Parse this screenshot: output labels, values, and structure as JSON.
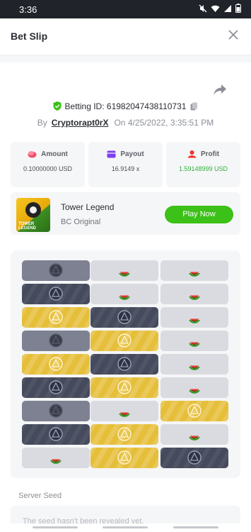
{
  "status_bar": {
    "time": "3:36"
  },
  "header": {
    "title": "Bet Slip",
    "close_icon": "close-icon"
  },
  "bet": {
    "betting_id": "Betting ID: 61982047438110731",
    "by_label": "By",
    "user": "Cryptorapt0rX",
    "on_label": "On",
    "datetime": "4/25/2022, 3:35:51 PM"
  },
  "stats": [
    {
      "label": "Amount",
      "value": "0.10000000 USD",
      "icon": "coins-icon",
      "icon_color": "#f24e6b"
    },
    {
      "label": "Payout",
      "value": "16.9149 x",
      "icon": "wallet-icon",
      "icon_color": "#7b3ff2"
    },
    {
      "label": "Profit",
      "value": "1.59148999 USD",
      "icon": "profit-icon",
      "icon_color": "#e8342e"
    }
  ],
  "game": {
    "name": "Tower Legend",
    "subtitle": "BC Original",
    "play_label": "Play Now",
    "thumb_text": "TOWER LEGEND"
  },
  "board": {
    "rows": [
      [
        "slate-skull",
        "gray-melon",
        "gray-melon"
      ],
      [
        "dark-skull",
        "gray-melon",
        "gray-melon"
      ],
      [
        "gold-skull",
        "dark-skull",
        "gray-melon"
      ],
      [
        "slate-skull",
        "gold-skull",
        "gray-melon"
      ],
      [
        "gold-skull",
        "dark-skull",
        "gray-melon"
      ],
      [
        "dark-skull",
        "gold-skull",
        "gray-melon"
      ],
      [
        "slate-skull",
        "gray-melon",
        "gold-skull"
      ],
      [
        "dark-skull",
        "gold-skull",
        "gray-melon"
      ],
      [
        "gray-melon",
        "gold-skull",
        "dark-skull"
      ]
    ]
  },
  "seed": {
    "label": "Server Seed",
    "placeholder": "The seed hasn't been revealed yet."
  },
  "colors": {
    "accent_green": "#3bc117",
    "profit_green": "#2fb23a",
    "melon_red": "#e84a3c"
  }
}
